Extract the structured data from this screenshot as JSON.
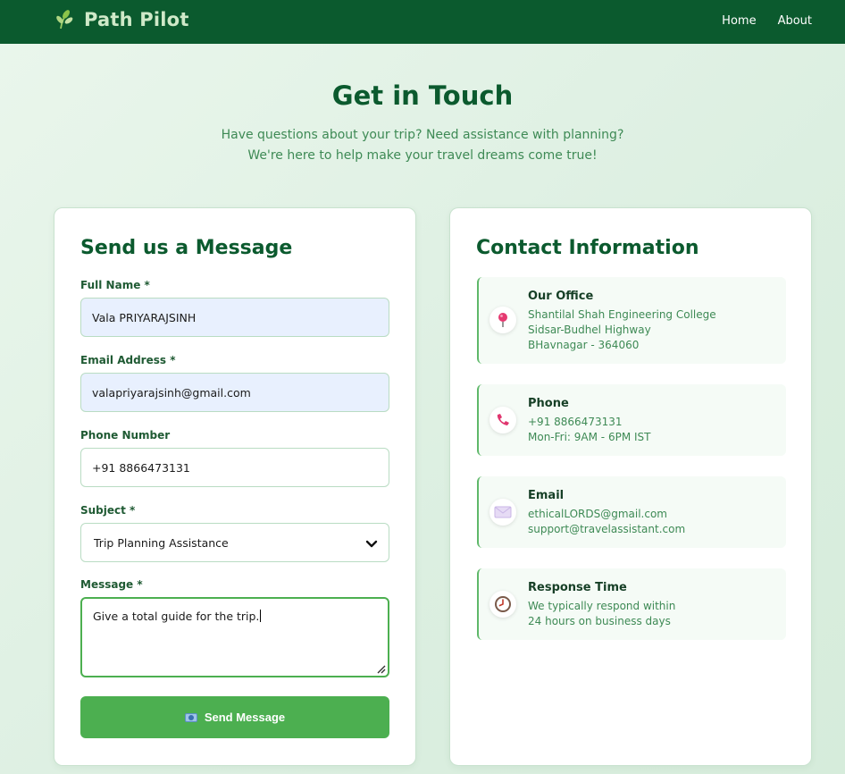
{
  "nav": {
    "brand": "Path Pilot",
    "links": [
      "Home",
      "About"
    ]
  },
  "hero": {
    "title": "Get in Touch",
    "subtitle_line1": "Have questions about your trip? Need assistance with planning?",
    "subtitle_line2": "We're here to help make your travel dreams come true!"
  },
  "form": {
    "title": "Send us a Message",
    "full_name": {
      "label": "Full Name *",
      "value": "Vala PRIYARAJSINH"
    },
    "email": {
      "label": "Email Address *",
      "value": "valapriyarajsinh@gmail.com"
    },
    "phone": {
      "label": "Phone Number",
      "value": "+91 8866473131"
    },
    "subject": {
      "label": "Subject *",
      "value": "Trip Planning Assistance"
    },
    "message": {
      "label": "Message *",
      "value": "Give a total guide for the trip."
    },
    "submit_label": "Send Message"
  },
  "contact": {
    "title": "Contact Information",
    "items": [
      {
        "icon": "pin-icon",
        "title": "Our Office",
        "lines": [
          "Shantilal Shah Engineering College",
          "Sidsar-Budhel Highway",
          "BHavnagar - 364060"
        ]
      },
      {
        "icon": "phone-icon",
        "title": "Phone",
        "lines": [
          "+91 8866473131",
          "Mon-Fri: 9AM - 6PM IST"
        ]
      },
      {
        "icon": "envelope-icon",
        "title": "Email",
        "lines": [
          "ethicalLORDS@gmail.com",
          "support@travelassistant.com"
        ]
      },
      {
        "icon": "clock-icon",
        "title": "Response Time",
        "lines": [
          "We typically respond within",
          "24 hours on business days"
        ]
      }
    ]
  },
  "colors": {
    "navbar": "#0b5a2e",
    "accent": "#4caf50",
    "heading": "#0b5a2e",
    "subtext": "#3e8a55"
  }
}
